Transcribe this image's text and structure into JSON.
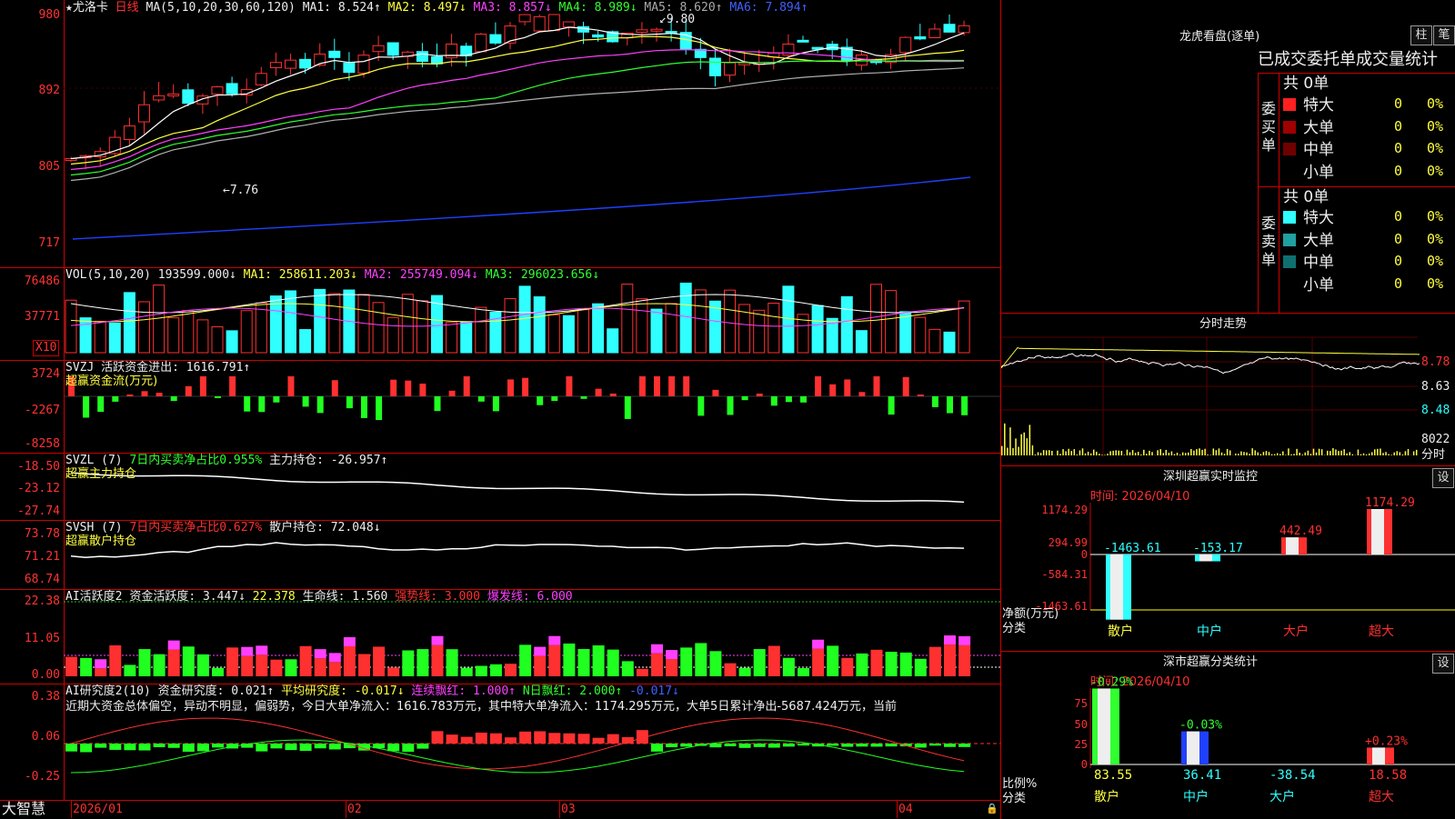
{
  "colors": {
    "up": "#ff3030",
    "down": "#30ffff",
    "ma1": "#ffffff",
    "ma2": "#ffff40",
    "ma3": "#ff40ff",
    "ma4": "#30ff30",
    "ma5": "#b0b0b0",
    "ma6": "#2040ff",
    "grid": "#cc0000"
  },
  "kline": {
    "title": "★尤洛卡",
    "period": "日线",
    "ma_head": "MA(5,10,20,30,60,120)",
    "ma1": "MA1: 8.524↑",
    "ma2": "MA2: 8.497↓",
    "ma3": "MA3: 8.857↓",
    "ma4": "MA4: 8.989↓",
    "ma5": "MA5: 8.620↑",
    "ma6": "MA6: 7.894↑",
    "yticks": [
      "980",
      "892",
      "805",
      "717"
    ],
    "high_mark": "9.80",
    "low_mark": "7.76"
  },
  "vol": {
    "head": "VOL(5,10,20)",
    "val": "193599.000↓",
    "ma1": "MA1: 258611.203↓",
    "ma2": "MA2: 255749.094↓",
    "ma3": "MA3: 296023.656↓",
    "yticks": [
      "76486",
      "37771"
    ],
    "unit": "X10"
  },
  "svzj": {
    "head": "SVZJ  活跃资金进出: 1616.791↑",
    "sub": "超赢资金流(万元)",
    "yticks": [
      "3724",
      "-2267",
      "-8258"
    ]
  },
  "svzl": {
    "head": "SVZL (7)",
    "h2": "7日内买卖净占比0.955%",
    "h3": "主力持仓: -26.957↑",
    "sub": "超赢主力持仓",
    "yticks": [
      "-18.50",
      "-23.12",
      "-27.74"
    ]
  },
  "svsh": {
    "head": "SVSH (7)",
    "h2": "7日内买卖净占比0.627%",
    "h3": "散户持仓: 72.048↓",
    "sub": "超赢散户持仓",
    "yticks": [
      "73.78",
      "71.21",
      "68.74"
    ]
  },
  "ai1": {
    "head": "AI活跃度2",
    "h2": "资金活跃度: 3.447↓",
    "h3": "22.378",
    "h4": "生命线: 1.560",
    "h5": "强势线: 3.000",
    "h6": "爆发线: 6.000",
    "yticks": [
      "22.38",
      "11.05",
      "0.00"
    ]
  },
  "ai2": {
    "head": "AI研究度2(10)",
    "h2": "资金研究度: 0.021↑",
    "h3": "平均研究度: -0.017↓",
    "h4": "连续飘红: 1.000↑",
    "h5": "N日飘红: 2.000↑",
    "h6": "-0.017↓",
    "comment": "近期大资金总体偏空，异动不明显，偏弱势，今日大单净流入：1616.783万元，其中特大单净流入：1174.295万元，大单5日累计净出-5687.424万元，当前",
    "yticks": [
      "0.38",
      "0.06",
      "-0.25"
    ]
  },
  "xaxis": {
    "brand": "大智慧",
    "labels": [
      "2026/01",
      "02",
      "03",
      "04"
    ]
  },
  "lhb": {
    "title": "龙虎看盘(逐单)",
    "btn1": "柱",
    "btn2": "笔",
    "tabs": "已成交委托单成交量统计",
    "buy_label": "委买单",
    "sell_label": "委卖单",
    "buy_total": "共 0单",
    "sell_total": "共 0单",
    "buy_rows": [
      {
        "name": "特大",
        "n": "0",
        "p": "0%",
        "c": "#ff2020"
      },
      {
        "name": "大单",
        "n": "0",
        "p": "0%",
        "c": "#a00000"
      },
      {
        "name": "中单",
        "n": "0",
        "p": "0%",
        "c": "#700000"
      },
      {
        "name": "小单",
        "n": "0",
        "p": "0%",
        "c": ""
      }
    ],
    "sell_rows": [
      {
        "name": "特大",
        "n": "0",
        "p": "0%",
        "c": "#30ffff"
      },
      {
        "name": "大单",
        "n": "0",
        "p": "0%",
        "c": "#20a0a0"
      },
      {
        "name": "中单",
        "n": "0",
        "p": "0%",
        "c": "#107070"
      },
      {
        "name": "小单",
        "n": "0",
        "p": "0%",
        "c": ""
      }
    ]
  },
  "fenshi": {
    "title": "分时走势",
    "yticks": [
      "8.78",
      "8.63",
      "8.48"
    ],
    "vol": "8022",
    "label": "分时"
  },
  "sz": {
    "title": "深圳超赢实时监控",
    "btn": "设",
    "time": "时间: 2026/04/10",
    "yticks": [
      "1174.29",
      "294.99",
      "0",
      "-584.31",
      "-1463.61"
    ],
    "ylab": "净额(万元)",
    "xlab": "分类",
    "chart_data": {
      "type": "bar",
      "categories": [
        "散户",
        "中户",
        "大户",
        "超大"
      ],
      "values": [
        -1463.61,
        -153.17,
        442.49,
        1174.29
      ]
    }
  },
  "sc": {
    "title": "深市超赢分类统计",
    "btn": "设",
    "time": "时间: 2026/04/10",
    "yticks": [
      "75",
      "50",
      "25",
      "0"
    ],
    "ylab": "比例%",
    "xlab": "分类",
    "chart_data": {
      "type": "bar",
      "categories": [
        "散户",
        "中户",
        "大户",
        "超大"
      ],
      "values": [
        83.55,
        36.41,
        -38.54,
        18.58
      ],
      "changes": [
        "-0.29%",
        "-0.03%",
        "",
        "+0.23%"
      ]
    }
  }
}
